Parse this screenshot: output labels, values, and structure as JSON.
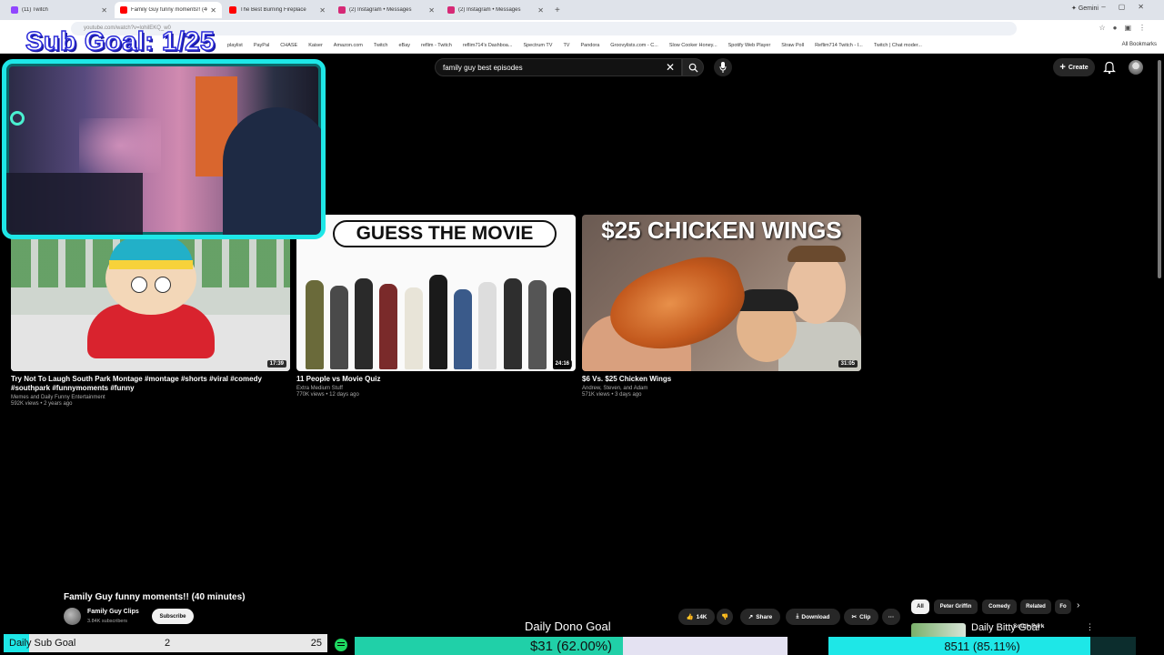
{
  "browser": {
    "tabs": [
      {
        "label": "(11) Twitch",
        "color": "#9146ff",
        "active": false
      },
      {
        "label": "Family Guy funny moments!! (40",
        "color": "#ff0000",
        "active": true
      },
      {
        "label": "The Best Burning Fireplace",
        "color": "#ff0000",
        "active": false
      },
      {
        "label": "(2) Instagram • Messages",
        "color": "#d62976",
        "active": false
      },
      {
        "label": "(2) Instagram • Messages",
        "color": "#d62976",
        "active": false
      }
    ],
    "new_tab": "+",
    "gemini_label": "Gemini",
    "url": "youtube.com/watch?v=lohilEKQ_w0",
    "bookmarks": [
      "playlist",
      "PayPal",
      "CHASE",
      "Kaiser",
      "Amazon.com",
      "Twitch",
      "eBay",
      "reflim - Twitch",
      "reflim714's Dashboa...",
      "Spectrum TV",
      "TV",
      "Pandora",
      "Groovylists.com - C...",
      "Slow Cooker Honey...",
      "Spotify Web Player",
      "Straw Poll",
      "Reflim714 Twitch - I...",
      "Twitch | Chat moder..."
    ],
    "all_bookmarks": "All Bookmarks"
  },
  "overlay": {
    "sub_goal_title": "Sub Goal: 1/25",
    "sub_bar": {
      "label": "Daily Sub Goal",
      "current": "2",
      "target": "25",
      "fill": 0.08
    },
    "dono_label": "Daily Dono Goal",
    "dono_bar": {
      "value": "$31 (62.00%)",
      "fill": 0.62
    },
    "daily_goal_label": "Daily Bitty Goal",
    "daily_bar": {
      "value": "8511 (85.11%)",
      "fill": 0.8511
    }
  },
  "youtube": {
    "search_query": "family guy best episodes",
    "create_label": "Create",
    "videos": [
      {
        "title": "Try Not To Laugh South Park Montage #montage #shorts #viral #comedy #southpark #funnymoments #funny",
        "channel": "Memes and Daily Funny Entertainment",
        "meta": "592K views • 2 years ago",
        "duration": "17:39"
      },
      {
        "title": "11 People vs Movie Quiz",
        "channel": "Extra Medium Stuff",
        "meta": "770K views • 12 days ago",
        "duration": "24:16",
        "banner": "GUESS THE MOVIE"
      },
      {
        "title": "$6 Vs. $25 Chicken Wings",
        "channel": "Andrew, Steven, and Adam",
        "meta": "571K views • 3 days ago",
        "duration": "31:05",
        "banner": "$25 CHICKEN WINGS"
      }
    ],
    "player": {
      "title": "Family Guy funny moments!! (40 minutes)",
      "channel": "Family Guy Clips",
      "subscribers": "3.84K subscribers",
      "subscribe_label": "Subscribe",
      "likes": "14K",
      "share_label": "Share",
      "download_label": "Download",
      "clip_label": "Clip"
    },
    "chips": [
      "All",
      "Peter Griffin",
      "Comedy",
      "Related",
      "Fo"
    ],
    "rec_title": "South Park"
  }
}
